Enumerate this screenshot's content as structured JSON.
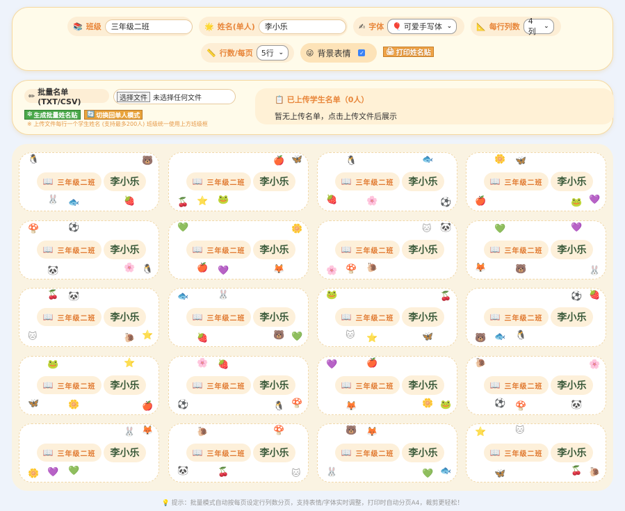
{
  "controls": {
    "class_label": "班级",
    "class_value": "三年级二班",
    "name_label": "姓名(单人)",
    "name_value": "李小乐",
    "font_label": "字体",
    "font_value": "可爱手写体",
    "cols_label": "每行列数",
    "cols_value": "4列",
    "rows_label": "行数/每页",
    "rows_value": "5行",
    "emoji_label": "背景表情",
    "print_label": "打印姓名贴"
  },
  "batch": {
    "upload_label": "批量名单 (TXT/CSV)",
    "file_button": "选择文件",
    "file_status": "未选择任何文件",
    "generate_label": "生成批量姓名贴",
    "switch_label": "切换回单人模式",
    "hint": "※ 上传文件每行一个学生姓名 (支持最多200人) 班级统一使用上方班级框",
    "uploaded_title": "已上传学生名单（0人）",
    "uploaded_empty": "暂无上传名单，点击上传文件后展示"
  },
  "card": {
    "class_text": "三年级二班",
    "name_text": "李小乐"
  },
  "footer": "提示：批量模式自动按每页设定行列数分页，支持表情/字体实时调整，打印时自动分页A4，裁剪更轻松！"
}
